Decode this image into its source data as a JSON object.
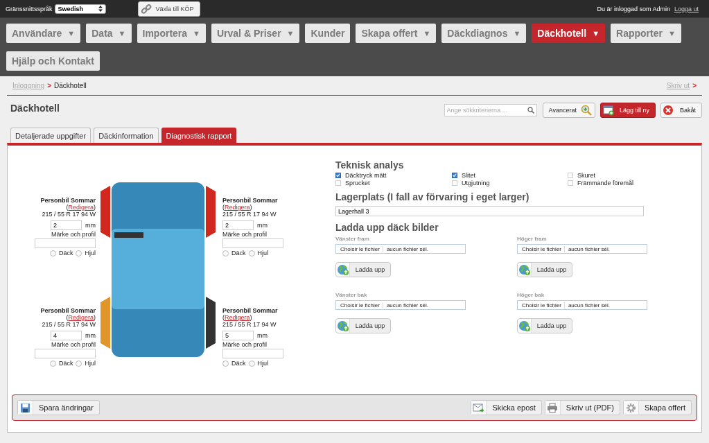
{
  "top_bar": {
    "language_label": "Gränssnittsspråk",
    "language": "Swedish",
    "switch_button": "Växla till KÖP",
    "user_text": "Du är inloggad som Admin",
    "logout": "Logga ut"
  },
  "nav": [
    {
      "label": "Användare",
      "dropdown": true,
      "selected": false
    },
    {
      "label": "Data",
      "dropdown": true,
      "selected": false
    },
    {
      "label": "Importera",
      "dropdown": true,
      "selected": false
    },
    {
      "label": "Urval & Priser",
      "dropdown": true,
      "selected": false
    },
    {
      "label": "Kunder",
      "dropdown": false,
      "selected": false
    },
    {
      "label": "Skapa offert",
      "dropdown": true,
      "selected": false
    },
    {
      "label": "Däckdiagnos",
      "dropdown": true,
      "selected": false
    },
    {
      "label": "Däckhotell",
      "dropdown": true,
      "selected": true
    },
    {
      "label": "Rapporter",
      "dropdown": true,
      "selected": false
    },
    {
      "label": "Hjälp och Kontakt",
      "dropdown": false,
      "selected": false
    }
  ],
  "dropdown_mark": "▼",
  "breadcrumb": {
    "link": "Inloggning",
    "separator": ">",
    "current": "Däckhotell",
    "print": "Skriv ut",
    "print_arrow": ">"
  },
  "page_title": "Däckhotell",
  "search": {
    "placeholder": "Ange sökkriterierna ..."
  },
  "header_buttons": [
    {
      "label": "Avancerat",
      "kind": "advanced"
    },
    {
      "label": "Lägg till ny",
      "kind": "add"
    },
    {
      "label": "Bakåt",
      "kind": "back"
    }
  ],
  "tabs": [
    {
      "label": "Detaljerade uppgifter",
      "selected": false
    },
    {
      "label": "Däckinformation",
      "selected": false
    },
    {
      "label": "Diagnostisk rapport",
      "selected": true
    }
  ],
  "wheels": [
    {
      "kind": "left",
      "title": "Personbil Sommar",
      "paren_open": "(",
      "edit": "Redigera",
      "paren_close": ")",
      "size": "215 / 55 R 17 94 W",
      "depth": "2",
      "unit": "mm",
      "brand_label": "Märke och profil",
      "color": "#d0281f",
      "options": [
        {
          "label": "Däck",
          "selected": false
        },
        {
          "label": "Hjul",
          "selected": false
        }
      ]
    },
    {
      "kind": "right",
      "title": "Personbil Sommar",
      "paren_open": "(",
      "edit": "Redigera",
      "paren_close": ")",
      "size": "215 / 55 R 17 94 W",
      "depth": "2",
      "unit": "mm",
      "brand_label": "Märke och profil",
      "color": "#d0281f",
      "options": [
        {
          "label": "Däck",
          "selected": false
        },
        {
          "label": "Hjul",
          "selected": false
        }
      ]
    },
    {
      "kind": "left",
      "title": "Personbil Sommar",
      "paren_open": "(",
      "edit": "Redigera",
      "paren_close": ")",
      "size": "215 / 55 R 17 94 W",
      "depth": "4",
      "unit": "mm",
      "brand_label": "Märke och profil",
      "color": "#e0962a",
      "options": [
        {
          "label": "Däck",
          "selected": false
        },
        {
          "label": "Hjul",
          "selected": false
        }
      ]
    },
    {
      "kind": "right",
      "title": "Personbil Sommar",
      "paren_open": "(",
      "edit": "Redigera",
      "paren_close": ")",
      "size": "215 / 55 R 17 94 W",
      "depth": "5",
      "unit": "mm",
      "brand_label": "Märke och profil",
      "color": "#333333",
      "options": [
        {
          "label": "Däck",
          "selected": false
        },
        {
          "label": "Hjul",
          "selected": false
        }
      ]
    }
  ],
  "analysis": {
    "title": "Teknisk analys",
    "checks": [
      {
        "label": "Däcktryck mätt",
        "checked": true
      },
      {
        "label": "Slitet",
        "checked": true
      },
      {
        "label": "Skuret",
        "checked": false
      },
      {
        "label": "Sprucket",
        "checked": false
      },
      {
        "label": "Utgjutning",
        "checked": false
      },
      {
        "label": "Främmande föremål",
        "checked": false
      }
    ]
  },
  "storage": {
    "title": "Lagerplats (I fall av förvaring i eget larger)",
    "value": "Lagerhall 3"
  },
  "uploads": {
    "title": "Ladda upp däck bilder",
    "slots": [
      {
        "label": "Vänster fram",
        "choose": "Choisir le fichier",
        "file": "aucun fichier sél.",
        "button": "Ladda upp"
      },
      {
        "label": "Höger fram",
        "choose": "Choisir le fichier",
        "file": "aucun fichier sél.",
        "button": "Ladda upp"
      },
      {
        "label": "Vänster bak",
        "choose": "Choisir le fichier",
        "file": "aucun fichier sél.",
        "button": "Ladda upp"
      },
      {
        "label": "Höger bak",
        "choose": "Choisir le fichier",
        "file": "aucun fichier sél.",
        "button": "Ladda upp"
      }
    ]
  },
  "footer": {
    "left": [
      {
        "label": "Spara ändringar",
        "kind": "save"
      }
    ],
    "right": [
      {
        "label": "Skicka epost",
        "kind": "email"
      },
      {
        "label": "Skriv ut (PDF)",
        "kind": "print"
      },
      {
        "label": "Skapa offert",
        "kind": "gear"
      }
    ]
  }
}
